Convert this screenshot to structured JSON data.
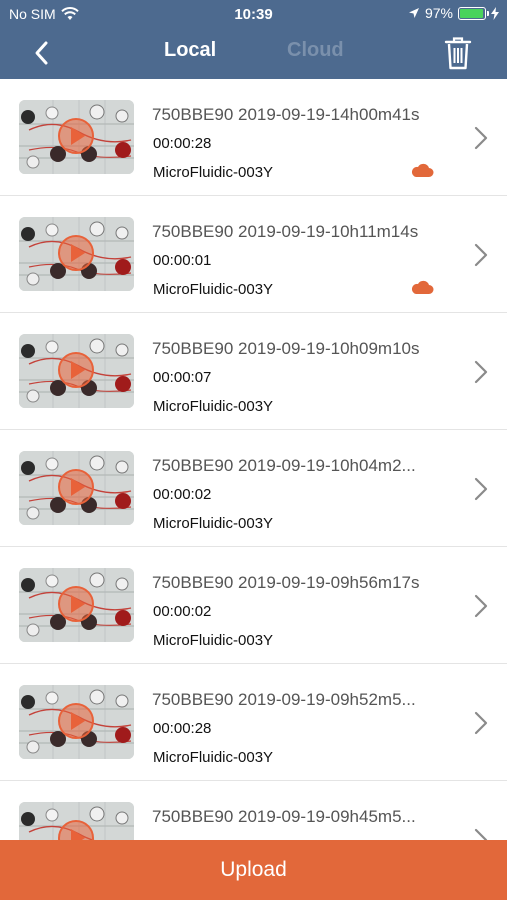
{
  "status": {
    "carrier": "No SIM",
    "time": "10:39",
    "battery": "97%",
    "battery_level": 0.97,
    "battery_color": "#49d35c"
  },
  "nav": {
    "tabs": [
      {
        "label": "Local",
        "active": true
      },
      {
        "label": "Cloud",
        "active": false
      }
    ],
    "icons": {
      "back": "chevron-left-icon",
      "delete": "trash-icon"
    }
  },
  "videos": [
    {
      "title": "750BBE90 2019-09-19-14h00m41s",
      "duration": "00:00:28",
      "device": "MicroFluidic-003Y",
      "cloud": true
    },
    {
      "title": "750BBE90 2019-09-19-10h11m14s",
      "duration": "00:00:01",
      "device": "MicroFluidic-003Y",
      "cloud": true
    },
    {
      "title": "750BBE90 2019-09-19-10h09m10s",
      "duration": "00:00:07",
      "device": "MicroFluidic-003Y",
      "cloud": false
    },
    {
      "title": "750BBE90 2019-09-19-10h04m2...",
      "duration": "00:00:02",
      "device": "MicroFluidic-003Y",
      "cloud": false
    },
    {
      "title": "750BBE90 2019-09-19-09h56m17s",
      "duration": "00:00:02",
      "device": "MicroFluidic-003Y",
      "cloud": false
    },
    {
      "title": "750BBE90 2019-09-19-09h52m5...",
      "duration": "00:00:28",
      "device": "MicroFluidic-003Y",
      "cloud": false
    },
    {
      "title": "750BBE90 2019-09-19-09h45m5...",
      "duration": "",
      "device": "",
      "cloud": false
    }
  ],
  "footer": {
    "upload_label": "Upload"
  },
  "colors": {
    "header": "#4d6a8f",
    "accent": "#e2683a",
    "cloud": "#e2683a"
  }
}
